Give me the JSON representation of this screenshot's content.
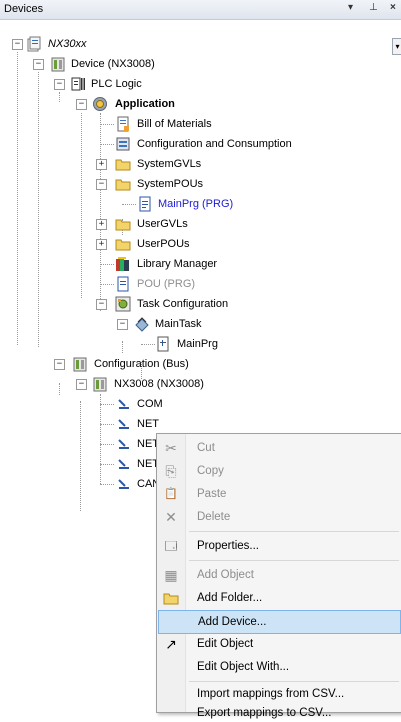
{
  "panel": {
    "title": "Devices",
    "pin_glyph": "▾",
    "autohide_glyph": "⊥",
    "close_glyph": "×",
    "dropdown_glyph": "▾"
  },
  "tree": {
    "root": "NX30xx",
    "device": "Device (NX3008)",
    "plc_logic": "PLC Logic",
    "application": "Application",
    "bill_of_materials": "Bill of Materials",
    "config_consumption": "Configuration and Consumption",
    "system_gvls": "SystemGVLs",
    "system_pous": "SystemPOUs",
    "mainprg_prg": "MainPrg (PRG)",
    "user_gvls": "UserGVLs",
    "user_pous": "UserPOUs",
    "library_manager": "Library Manager",
    "pou_prg": "POU (PRG)",
    "task_configuration": "Task Configuration",
    "main_task": "MainTask",
    "mainprg": "MainPrg",
    "configuration_bus": "Configuration (Bus)",
    "nx3008": "NX3008 (NX3008)",
    "children": [
      "COM",
      "NET",
      "NET",
      "NET",
      "CAN"
    ]
  },
  "context_menu": {
    "items": [
      {
        "label": "Cut",
        "icon": "✂",
        "disabled": true
      },
      {
        "label": "Copy",
        "icon": "⎘",
        "disabled": true
      },
      {
        "label": "Paste",
        "icon": "📋",
        "disabled": true
      },
      {
        "label": "Delete",
        "icon": "✕",
        "disabled": true
      },
      {
        "label": "Properties...",
        "icon": "🗔",
        "disabled": false
      },
      {
        "label": "Add Object",
        "icon": "▦",
        "disabled": true
      },
      {
        "label": "Add Folder...",
        "icon": "📁",
        "disabled": false
      },
      {
        "label": "Add Device...",
        "icon": "",
        "disabled": false
      },
      {
        "label": "Edit Object",
        "icon": "↗",
        "disabled": false
      },
      {
        "label": "Edit Object With...",
        "icon": "",
        "disabled": false
      },
      {
        "label": "Import mappings from CSV...",
        "icon": "",
        "disabled": false
      },
      {
        "label": "Export mappings to CSV...",
        "icon": "",
        "disabled": false
      }
    ]
  },
  "colors": {
    "highlight": "#cde4f7",
    "link_blue": "#1c1cd6",
    "disabled_gray": "#8d8d8d",
    "folder_yellow": "#f3d46a"
  }
}
